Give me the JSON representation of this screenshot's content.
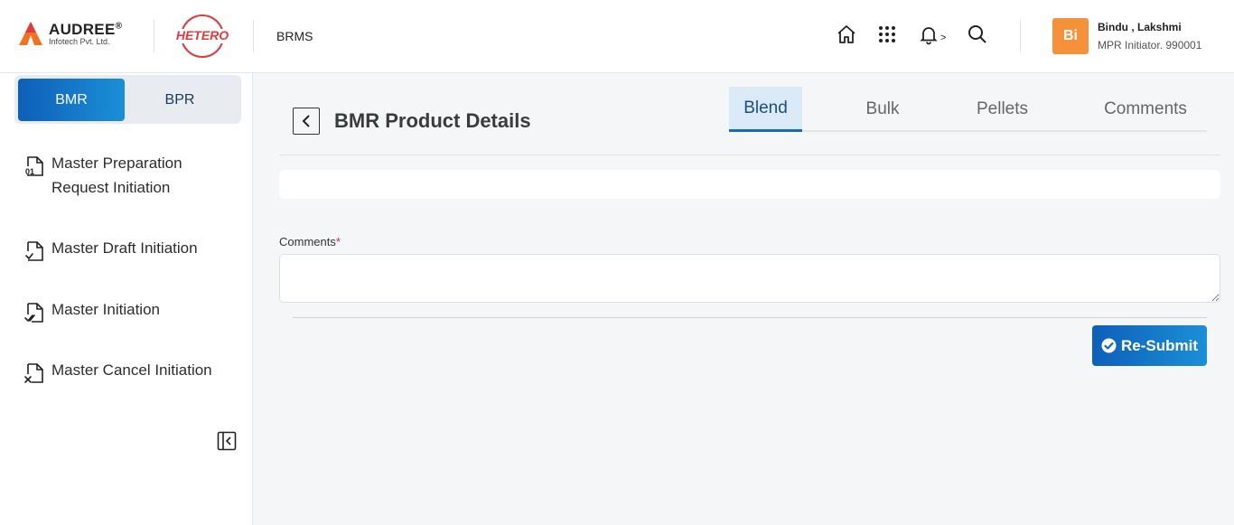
{
  "header": {
    "company_name": "AUDREE",
    "company_mark": "®",
    "company_sub": "Infotech Pvt. Ltd.",
    "client_logo_text": "HETERO",
    "app_name": "BRMS",
    "icons": [
      "home-icon",
      "apps-grid-icon",
      "bell-icon",
      "search-icon"
    ],
    "notification_indicator": ">",
    "user": {
      "initials": "Bi",
      "name": "Bindu , Lakshmi",
      "role": "MPR Initiator. 990001"
    }
  },
  "sidebar": {
    "segments": [
      {
        "label": "BMR",
        "active": true
      },
      {
        "label": "BPR",
        "active": false
      }
    ],
    "items": [
      {
        "label": "Master Preparation Request Initiation",
        "icon": "document-01-icon"
      },
      {
        "label": "Master Draft Initiation",
        "icon": "document-draft-icon"
      },
      {
        "label": "Master Initiation",
        "icon": "document-check-icon"
      },
      {
        "label": "Master Cancel Initiation",
        "icon": "document-cancel-icon"
      }
    ]
  },
  "main": {
    "title": "BMR Product Details",
    "tabs": [
      {
        "label": "Blend",
        "active": true
      },
      {
        "label": "Bulk",
        "active": false
      },
      {
        "label": "Pellets",
        "active": false
      },
      {
        "label": "Comments",
        "active": false
      }
    ],
    "comments_label": "Comments",
    "required_mark": "*",
    "comments_value": "",
    "resubmit_label": "Re-Submit"
  },
  "colors": {
    "primary": "#1669b8",
    "avatar": "#f4913a",
    "brand_red": "#e03a3e",
    "brand_orange": "#f37021"
  }
}
